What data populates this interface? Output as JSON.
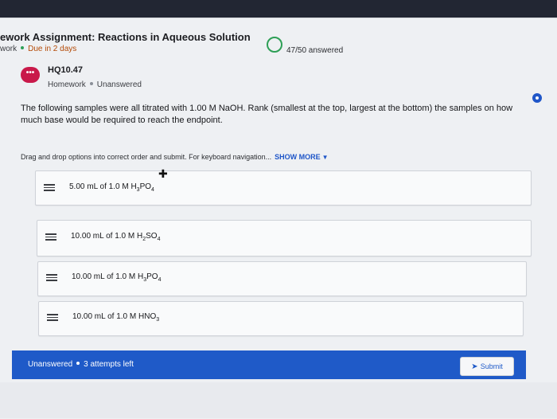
{
  "header": {
    "title": "ework Assignment: Reactions in Aqueous Solution",
    "type_label": "work",
    "due": "Due in 2 days"
  },
  "progress": {
    "answered": 47,
    "total": 50,
    "text": "47/50 answered"
  },
  "question": {
    "badge": "•••",
    "id": "HQ10.47",
    "category": "Homework",
    "status": "Unanswered",
    "prompt": "The following samples were all titrated with 1.00 M NaOH. Rank (smallest at the top, largest at the bottom) the samples on how much base would be required to reach the endpoint.",
    "instructions": "Drag and drop options into correct order and submit. For keyboard navigation...",
    "show_more": "SHOW MORE"
  },
  "options": [
    {
      "pre": "5.00 mL of 1.0 M H",
      "s1": "3",
      "mid": "PO",
      "s2": "4"
    },
    {
      "pre": "10.00 mL of 1.0 M H",
      "s1": "2",
      "mid": "SO",
      "s2": "4"
    },
    {
      "pre": "10.00 mL of 1.0 M H",
      "s1": "3",
      "mid": "PO",
      "s2": "4"
    },
    {
      "pre": "10.00 mL of 1.0 M HNO",
      "s1": "",
      "mid": "",
      "s2": "3"
    }
  ],
  "footer": {
    "status": "Unanswered",
    "attempts": "3 attempts left",
    "submit_label": "Submit"
  },
  "colors": {
    "accent": "#1f5ac8",
    "badge": "#c9194a",
    "due": "#b44a06",
    "progress_ring": "#2e9f56"
  }
}
